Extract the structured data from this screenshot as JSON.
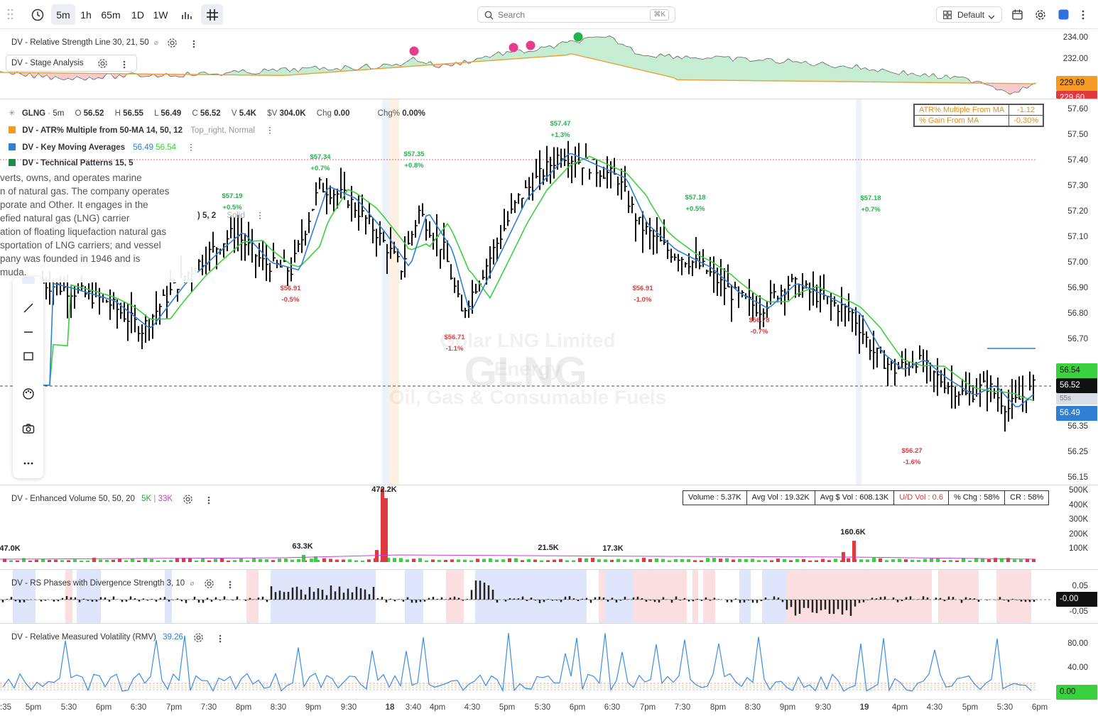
{
  "toolbar": {
    "timeframes": [
      {
        "label": "5m",
        "active": true
      },
      {
        "label": "1h",
        "active": false
      },
      {
        "label": "65m",
        "active": false
      },
      {
        "label": "1D",
        "active": false
      },
      {
        "label": "1W",
        "active": false
      }
    ],
    "search_placeholder": "Search",
    "search_shortcut": "⌘K",
    "layout_label": "Default"
  },
  "rs_pane": {
    "title": "DV - Relative Strength Line 30, 21, 50",
    "sub_title": "DV - Stage Analysis",
    "axis_labels": [
      "234.00",
      "232.00"
    ],
    "tag_value": "229.69",
    "tag_value2": "229.60",
    "colors": {
      "up_fill": "#bfeecb",
      "down_fill": "#f7c6c9",
      "ma": "#e8a23c",
      "dot_pink": "#e63c8c",
      "dot_green": "#22b34a"
    }
  },
  "main_pane": {
    "symbol": "GLNG",
    "interval": "5m",
    "ohlc": {
      "O": "56.52",
      "H": "56.55",
      "L": "56.49",
      "C": "56.52",
      "V": "5.4K",
      "$V": "304.0K",
      "Chg": "0.00",
      "Chg%": "0.00%"
    },
    "indicators": [
      {
        "name": "DV - ATR% Multiple from 50-MA 14, 50, 12",
        "extra": "Top_right, Normal",
        "color": "#f59b23"
      },
      {
        "name": "DV - Key Moving Averages",
        "values": [
          "56.49",
          "56.54"
        ],
        "color": "#2f7fd4"
      },
      {
        "name": "DV - Technical Patterns 15, 5",
        "color": "#1f8a4c"
      }
    ],
    "hidden_indicator_tail": ") 5, 2",
    "hidden_indicator_style": "Solid",
    "atr_table": [
      {
        "label": "ATR% Multiple From MA",
        "value": "-1.12"
      },
      {
        "label": "% Gain From MA",
        "value": "-0.30%"
      }
    ],
    "description_lines": [
      "verts, owns, and operates marine",
      "n of natural gas. The company operates",
      "porate and Other. It engages in the",
      "efied natural gas (LNG) carrier",
      "ation of floating liquefaction natural gas",
      "sportation of LNG carriers; and vessel",
      "pany was founded in 1946 and is",
      "muda."
    ],
    "watermark": {
      "ticker": "GLNG",
      "company": "Golar LNG Limited",
      "sector": "Energy",
      "industry": "Oil, Gas & Consumable Fuels"
    },
    "price_axis": [
      "57.60",
      "57.50",
      "57.40",
      "57.30",
      "57.20",
      "57.10",
      "57.00",
      "56.90",
      "56.80",
      "56.70",
      "56.60",
      "56.50",
      "56.35",
      "56.25",
      "56.15"
    ],
    "price_tags": [
      {
        "value": "56.54",
        "color": "#3ad13f"
      },
      {
        "value": "56.52",
        "color": "#111111"
      },
      {
        "value": "55s",
        "color": "#d8dde6"
      },
      {
        "value": "56.49",
        "color": "#2f7fd4"
      }
    ],
    "pivot_labels": [
      {
        "price": "$57.19",
        "pct": "+0.5%",
        "type": "high"
      },
      {
        "price": "$57.34",
        "pct": "+0.7%",
        "type": "high"
      },
      {
        "price": "$57.35",
        "pct": "+0.8%",
        "type": "high"
      },
      {
        "price": "$57.47",
        "pct": "+1.3%",
        "type": "high"
      },
      {
        "price": "$57.18",
        "pct": "+0.5%",
        "type": "high"
      },
      {
        "price": "$57.18",
        "pct": "+0.7%",
        "type": "high"
      },
      {
        "price": "$56.91",
        "pct": "-0.5%",
        "type": "low"
      },
      {
        "price": "$56.71",
        "pct": "-1.1%",
        "type": "low"
      },
      {
        "price": "$56.91",
        "pct": "-1.0%",
        "type": "low"
      },
      {
        "price": "$56.78",
        "pct": "-0.7%",
        "type": "low"
      },
      {
        "price": "$56.27",
        "pct": "-1.6%",
        "type": "low"
      }
    ],
    "colors": {
      "ma_fast": "#2f7fd4",
      "ma_slow": "#3ad13f",
      "high_label": "#22b34a",
      "low_label": "#e0393e"
    }
  },
  "volume_pane": {
    "title": "DV - Enhanced Volume 50, 50, 20",
    "v1": "5K",
    "v2": "33K",
    "axis": [
      "500K",
      "400K",
      "300K",
      "200K",
      "100K"
    ],
    "stats": [
      "Volume : 5.37K",
      "Avg Vol : 19.32K",
      "Avg $ Vol : 608.13K",
      "U/D Vol : 0.6",
      "% Chg : 58%",
      "CR : 58%"
    ],
    "bar_labels": [
      "47.0K",
      "63.3K",
      "472.2K",
      "21.5K",
      "17.3K",
      "160.6K"
    ]
  },
  "rs_phases_pane": {
    "title": "DV - RS Phases with Divergence Strength 3, 10",
    "axis": [
      "0.05",
      "-0.05"
    ],
    "tag_value": "-0.00"
  },
  "rmv_pane": {
    "title": "DV - Relative Measured Volatility (RMV)",
    "value": "39.26",
    "axis": [
      "80.00",
      "40.00"
    ],
    "tag_value": "0.00"
  },
  "time_axis": [
    ":35",
    "5pm",
    "5:30",
    "6pm",
    "6:30",
    "7pm",
    "7:30",
    "8pm",
    "8:30",
    "9pm",
    "9:30",
    "18",
    "3:40",
    "4pm",
    "4:30",
    "5pm",
    "5:30",
    "6pm",
    "6:30",
    "7pm",
    "7:30",
    "8pm",
    "8:30",
    "9pm",
    "9:30",
    "19",
    "4pm",
    "4:30",
    "5pm",
    "5:30",
    "6pm"
  ]
}
